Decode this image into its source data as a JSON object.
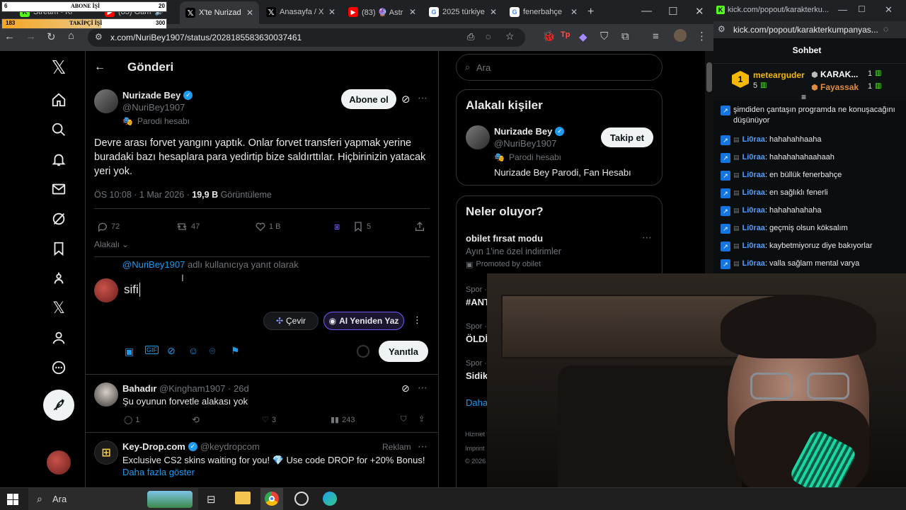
{
  "overlay": {
    "top_left_num": "6",
    "top_label": "ABONE İŞİ",
    "top_right_num": "20",
    "bottom_left_num": "183",
    "bottom_label": "TAKİPÇİ İŞİ",
    "bottom_right_num": "300"
  },
  "tabs": [
    {
      "label": "Stream - Ki",
      "fav": "K",
      "color": "#53fc18"
    },
    {
      "label": "(83) Gam",
      "fav": "▶",
      "color": "#ff0000"
    },
    {
      "label": "X'te Nurizad",
      "fav": "X",
      "color": "#000000"
    },
    {
      "label": "Anasayfa / X",
      "fav": "X",
      "color": "#000000"
    },
    {
      "label": "(83) 🔮 Astr",
      "fav": "▶",
      "color": "#ff0000"
    },
    {
      "label": "2025 türkiye",
      "fav": "G",
      "color": "#ffffff"
    },
    {
      "label": "fenerbahçe",
      "fav": "G",
      "color": "#ffffff"
    }
  ],
  "url": "x.com/NuriBey1907/status/2028185583630037461",
  "nav": {
    "x_icon": "x-logo-icon",
    "items": [
      "home-icon",
      "search-icon",
      "bell-icon",
      "mail-icon",
      "grok-icon",
      "bookmark-icon",
      "communities-icon",
      "x-icon",
      "profile-icon",
      "more-icon"
    ]
  },
  "header": {
    "back": "←",
    "title": "Gönderi"
  },
  "post": {
    "name": "Nurizade Bey",
    "handle": "@NuriBey1907",
    "parody": "Parodi hesabı",
    "subscribe": "Abone ol",
    "text": "Devre arası forvet yangını yaptık. Onlar forvet transferi yapmak yerine buradaki bazı hesaplara para yedirtip bize saldırttılar. Hiçbirinizin yatacak yeri yok.",
    "time": "ÖS 10:08 · 1 Mar 2026 · ",
    "views": "19,9 B",
    "views_label": " Görüntüleme",
    "replies": "72",
    "reposts": "47",
    "likes": "1 B",
    "bookmarks": "5"
  },
  "related": "Alakalı",
  "reply_box": {
    "replying_to": "@NuriBey1907",
    "replying_suffix": " adlı kullanıcıya yanıt olarak",
    "text": "sifi",
    "translate": "Çevir",
    "ai_rewrite": "AI Yeniden Yaz",
    "reply_button": "Yanıtla"
  },
  "replies": [
    {
      "name": "Bahadır",
      "handle": "@Kingham1907 · 26d",
      "text": "Şu oyunun forvetle alakası yok",
      "replies": "1",
      "reposts": "",
      "likes": "3",
      "views": "243"
    }
  ],
  "ad": {
    "name": "Key-Drop.com",
    "handle": "@keydropcom",
    "label": "Reklam",
    "text": "Exclusive CS2 skins waiting for you! 💎 Use code DROP for +20% Bonus!",
    "more": "Daha fazla göster"
  },
  "right": {
    "search_placeholder": "Ara",
    "related_people_title": "Alakalı kişiler",
    "person_name": "Nurizade Bey",
    "person_handle": "@NuriBey1907",
    "person_parody": "Parodi hesabı",
    "person_bio": "Nurizade Bey Parodi, Fan Hesabı",
    "follow": "Takip et",
    "trends_title": "Neler oluyor?",
    "trend1_title": "obilet fırsat modu",
    "trend1_sub": "Ayın 1'ine özel indirimler",
    "trend1_promo": "Promoted by obilet",
    "trend2_cat": "Spor ·",
    "trend2_title": "#ANT",
    "trend3_cat": "Spor ·",
    "trend3_title": "ÖLDİ",
    "trend4_cat": "Spor ·",
    "trend4_title": "Sidik",
    "more": "Daha",
    "footer1": "Hizmet",
    "footer2": "Imprint",
    "footer3": "© 2026"
  },
  "kick": {
    "url": "kick.com/popout/karakterkumpanyas...",
    "title_url": "kick.com/popout/karakterku...",
    "chat_title": "Sohbet",
    "leader1_name": "metearguder",
    "leader1_count": "5",
    "leader2_name": "KARAK...",
    "leader2_count": "1",
    "leader3_name": "Fayassak",
    "leader3_count": "1",
    "first_line": "şimdiden çantaşın programda ne konuşacağını düşünüyor",
    "messages": [
      {
        "user": "Li0raa",
        "text": ": hahahahhaaha"
      },
      {
        "user": "Li0raa",
        "text": ": hahahahahaahaah"
      },
      {
        "user": "Li0raa",
        "text": ": en büllük fenerbahçe"
      },
      {
        "user": "Li0raa",
        "text": ": en sağlıklı fenerli"
      },
      {
        "user": "Li0raa",
        "text": ": hahahahahaha"
      },
      {
        "user": "Li0raa",
        "text": ": geçmiş olsun köksalım"
      },
      {
        "user": "Li0raa",
        "text": ": kaybetmiyoruz diye bakıyorlar"
      },
      {
        "user": "Li0raa",
        "text": ": valla sağlam mental varya"
      }
    ]
  },
  "taskbar": {
    "search": "Ara"
  },
  "colors": {
    "accent": "#1d9bf0",
    "kick_green": "#53fc18",
    "bg": "#000000"
  }
}
